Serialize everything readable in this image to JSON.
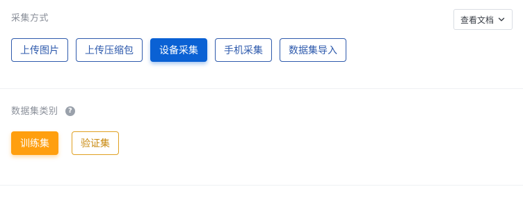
{
  "collection": {
    "label": "采集方式",
    "doc_button": {
      "label": "查看文档",
      "icon": "chevron-down-icon"
    },
    "options": [
      {
        "label": "上传图片",
        "selected": false
      },
      {
        "label": "上传压缩包",
        "selected": false
      },
      {
        "label": "设备采集",
        "selected": true
      },
      {
        "label": "手机采集",
        "selected": false
      },
      {
        "label": "数据集导入",
        "selected": false
      }
    ]
  },
  "dataset_category": {
    "label": "数据集类别",
    "help_icon": "question-circle-icon",
    "help_glyph": "?",
    "options": [
      {
        "label": "训练集",
        "selected": true
      },
      {
        "label": "验证集",
        "selected": false
      }
    ]
  },
  "colors": {
    "primary_blue": "#0a61d4",
    "blue_outline": "#2e5aac",
    "accent_orange": "#ff9f0f",
    "orange_outline": "#e0a020",
    "label_gray": "#8a8f99"
  }
}
